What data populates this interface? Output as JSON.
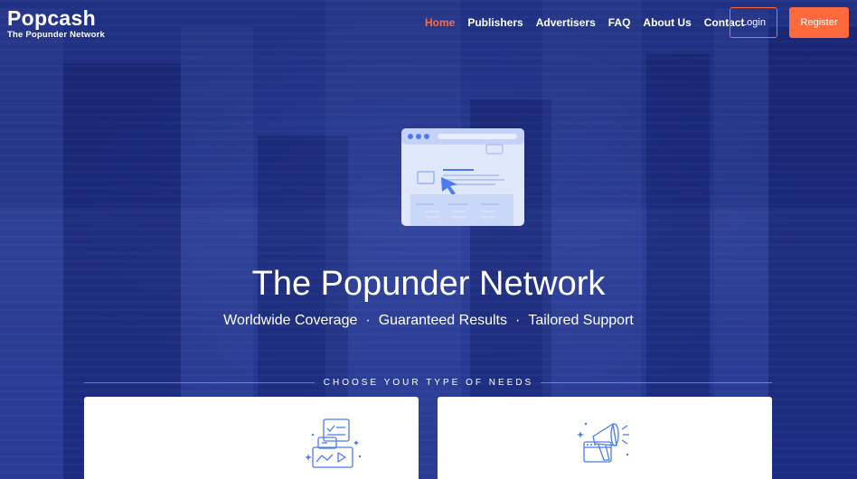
{
  "brand": {
    "name": "Popcash",
    "tagline": "The Popunder Network"
  },
  "nav": {
    "items": [
      {
        "label": "Home",
        "active": true
      },
      {
        "label": "Publishers",
        "active": false
      },
      {
        "label": "Advertisers",
        "active": false
      },
      {
        "label": "FAQ",
        "active": false
      },
      {
        "label": "About Us",
        "active": false
      },
      {
        "label": "Contact",
        "active": false
      }
    ],
    "login_label": "Login",
    "register_label": "Register"
  },
  "hero": {
    "title": "The Popunder Network",
    "features": [
      "Worldwide Coverage",
      "Guaranteed Results",
      "Tailored Support"
    ],
    "separator": "·"
  },
  "needs": {
    "label": "CHOOSE YOUR TYPE OF NEEDS",
    "cards": [
      {
        "icon": "publisher-content-icon"
      },
      {
        "icon": "advertiser-megaphone-icon"
      }
    ]
  },
  "colors": {
    "accent": "#ff6a3d",
    "background": "#22337e",
    "illustration_blue": "#4a7cf0"
  }
}
